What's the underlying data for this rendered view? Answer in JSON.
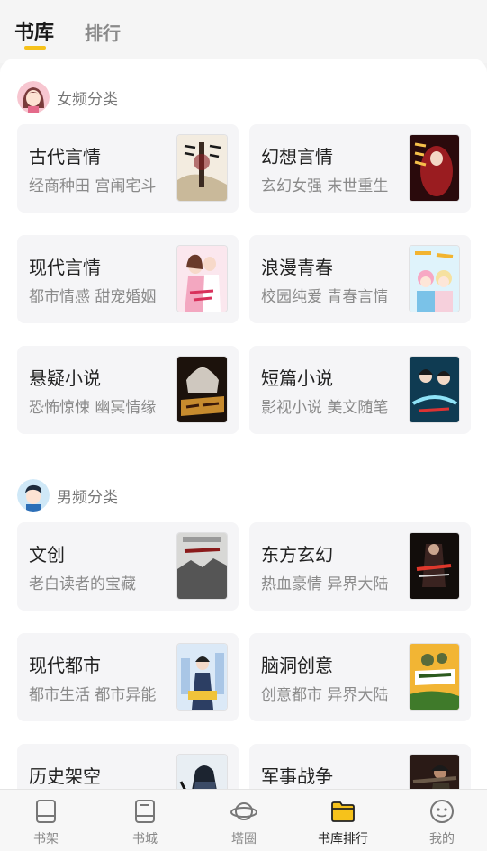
{
  "top_tabs": {
    "active": "书库",
    "inactive": "排行"
  },
  "colors": {
    "accent": "#f6c21b",
    "card_bg": "#f5f5f7",
    "subtitle": "#8a8a8a"
  },
  "female_section": {
    "title": "女频分类",
    "avatar_icon": "girl-avatar-icon",
    "categories": [
      {
        "title": "古代言情",
        "subtitle": "经商种田 宫闱宅斗"
      },
      {
        "title": "幻想言情",
        "subtitle": "玄幻女强 末世重生"
      },
      {
        "title": "现代言情",
        "subtitle": "都市情感 甜宠婚姻"
      },
      {
        "title": "浪漫青春",
        "subtitle": "校园纯爱 青春言情"
      },
      {
        "title": "悬疑小说",
        "subtitle": "恐怖惊悚 幽冥情缘"
      },
      {
        "title": "短篇小说",
        "subtitle": "影视小说 美文随笔"
      }
    ]
  },
  "male_section": {
    "title": "男频分类",
    "avatar_icon": "boy-avatar-icon",
    "categories": [
      {
        "title": "文创",
        "subtitle": "老白读者的宝藏"
      },
      {
        "title": "东方玄幻",
        "subtitle": "热血豪情 异界大陆"
      },
      {
        "title": "现代都市",
        "subtitle": "都市生活 都市异能"
      },
      {
        "title": "脑洞创意",
        "subtitle": "创意都市 异界大陆"
      },
      {
        "title": "历史架空",
        "subtitle": ""
      },
      {
        "title": "军事战争",
        "subtitle": ""
      }
    ]
  },
  "bottom_nav": {
    "items": [
      {
        "label": "书架",
        "icon": "bookshelf-icon"
      },
      {
        "label": "书城",
        "icon": "bookstore-icon"
      },
      {
        "label": "塔圈",
        "icon": "planet-icon"
      },
      {
        "label": "书库排行",
        "icon": "folder-icon",
        "active": true
      },
      {
        "label": "我的",
        "icon": "profile-face-icon"
      }
    ]
  }
}
